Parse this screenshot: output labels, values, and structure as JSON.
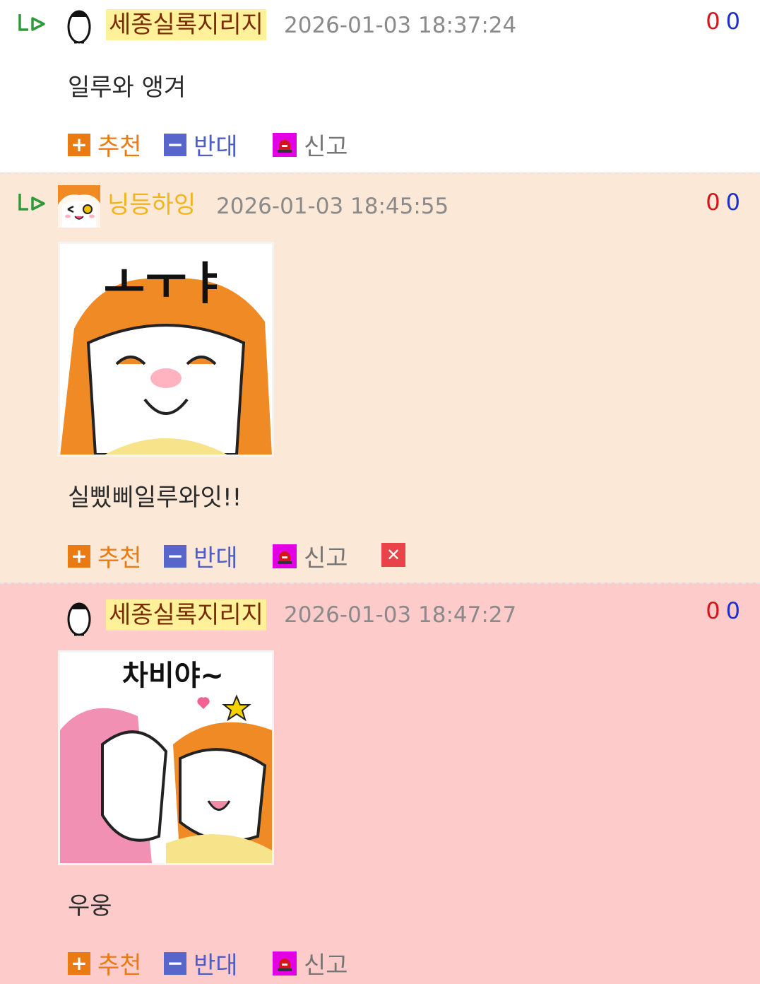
{
  "comments": [
    {
      "nickname": "세종실록지리지",
      "timestamp": "2026-01-03 18:37:24",
      "up": "0",
      "down": "0",
      "text": "일루와 앵겨",
      "actions": {
        "recommend": "추천",
        "oppose": "반대",
        "report": "신고"
      }
    },
    {
      "nickname": "닝등하잉",
      "timestamp": "2026-01-03 18:45:55",
      "up": "0",
      "down": "0",
      "sticker_text": "ㅗㅜㅑ",
      "text": "실삤삐일루와잇!!",
      "actions": {
        "recommend": "추천",
        "oppose": "반대",
        "report": "신고",
        "delete": "✕"
      }
    },
    {
      "nickname": "세종실록지리지",
      "timestamp": "2026-01-03 18:47:27",
      "up": "0",
      "down": "0",
      "sticker_text": "차비야~",
      "text": "우웅",
      "actions": {
        "recommend": "추천",
        "oppose": "반대",
        "report": "신고"
      }
    }
  ],
  "colors": {
    "reply_bg": "#fbe8d6",
    "highlight_bg": "#fecbcb",
    "recommend": "#ea7b12",
    "oppose": "#5866cc",
    "report": "#e400e4",
    "score_up": "#d41616",
    "score_down": "#1b2fcc"
  },
  "icons": {
    "reply": "reply-arrow-icon",
    "avatar_1": "penguin-icon",
    "avatar_2": "anime-avatar",
    "report": "siren-icon",
    "delete": "close-icon"
  }
}
